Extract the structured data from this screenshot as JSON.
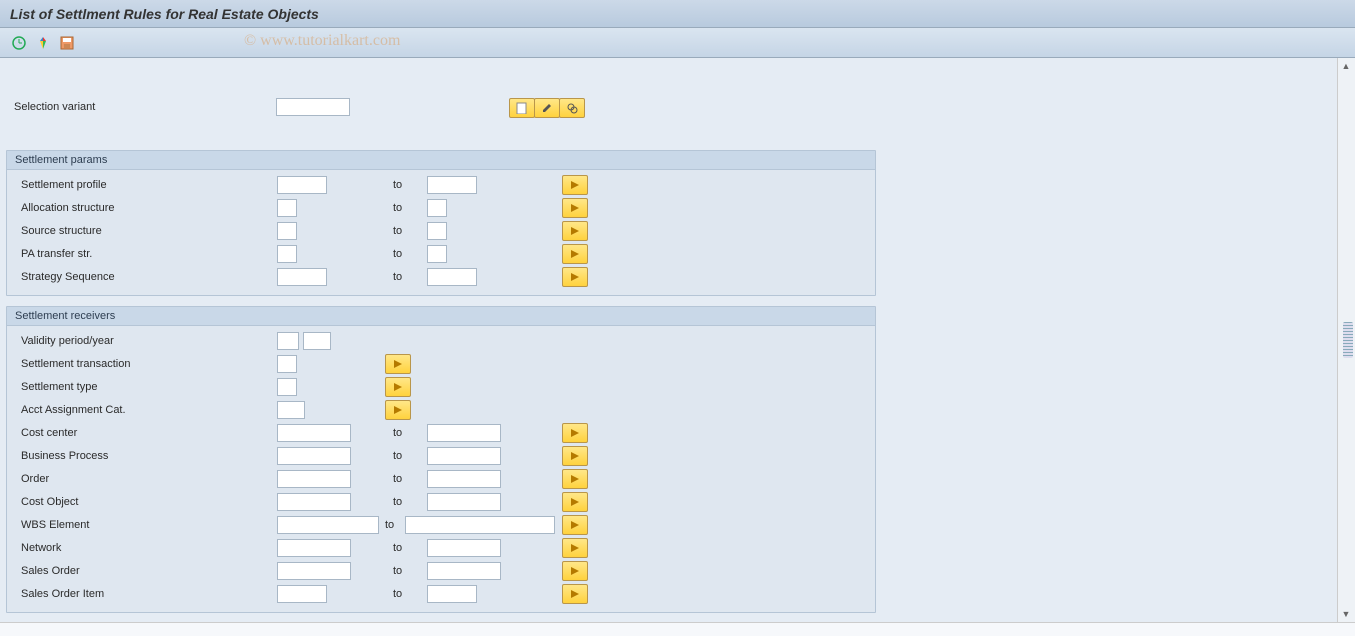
{
  "title": "List of Settlment Rules for Real Estate Objects",
  "watermark": "© www.tutorialkart.com",
  "selection": {
    "label": "Selection variant",
    "value": ""
  },
  "to_label": "to",
  "groups": {
    "settlement_params": {
      "title": "Settlement params",
      "rows": [
        {
          "label": "Settlement profile",
          "from": "",
          "to": "",
          "size": "md"
        },
        {
          "label": "Allocation structure",
          "from": "",
          "to": "",
          "size": "xs"
        },
        {
          "label": "Source structure",
          "from": "",
          "to": "",
          "size": "xs"
        },
        {
          "label": "PA transfer str.",
          "from": "",
          "to": "",
          "size": "xs"
        },
        {
          "label": "Strategy Sequence",
          "from": "",
          "to": "",
          "size": "md"
        }
      ]
    },
    "settlement_receivers": {
      "title": "Settlement receivers",
      "validity": {
        "label": "Validity period/year",
        "v1": "",
        "v2": ""
      },
      "singles": [
        {
          "label": "Settlement transaction",
          "val": ""
        },
        {
          "label": "Settlement type",
          "val": ""
        },
        {
          "label": "Acct Assignment Cat.",
          "val": ""
        }
      ],
      "ranges": [
        {
          "label": "Cost center",
          "from": "",
          "to": "",
          "size": "lg"
        },
        {
          "label": "Business Process",
          "from": "",
          "to": "",
          "size": "lg"
        },
        {
          "label": "Order",
          "from": "",
          "to": "",
          "size": "lg"
        },
        {
          "label": "Cost Object",
          "from": "",
          "to": "",
          "size": "lg"
        },
        {
          "label": "WBS Element",
          "from": "",
          "to": "",
          "size": "in-col1"
        },
        {
          "label": "Network",
          "from": "",
          "to": "",
          "size": "lg"
        },
        {
          "label": "Sales Order",
          "from": "",
          "to": "",
          "size": "lg"
        },
        {
          "label": "Sales Order Item",
          "from": "",
          "to": "",
          "size": "md"
        }
      ]
    }
  }
}
